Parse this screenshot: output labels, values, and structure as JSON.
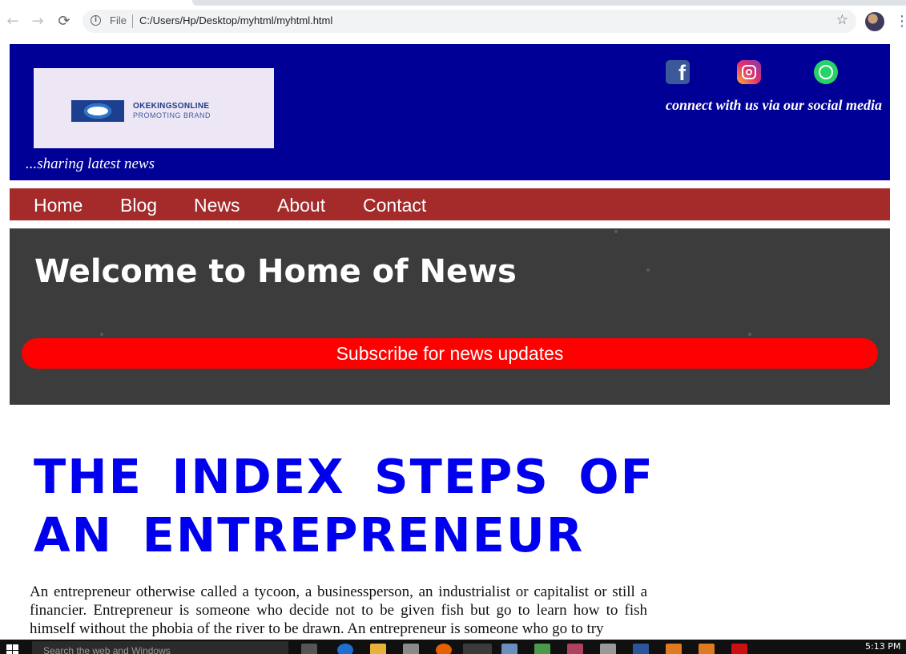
{
  "browser": {
    "file_label": "File",
    "url": "C:/Users/Hp/Desktop/myhtml/myhtml.html",
    "back_glyph": "←",
    "forward_glyph": "→",
    "reload_glyph": "⟳",
    "star_glyph": "☆",
    "menu_glyph": "⋮",
    "info_glyph": "i"
  },
  "header": {
    "logo_name": "OKEKINGSONLINE",
    "logo_tagline": "PROMOTING BRAND",
    "tagline": "...sharing latest news",
    "social_caption": "connect with us via our social media",
    "social_icons": [
      "facebook-icon",
      "instagram-icon",
      "whatsapp-icon"
    ],
    "facebook_glyph": "f",
    "background_color": "#000096"
  },
  "nav": {
    "items": [
      "Home",
      "Blog",
      "News",
      "About",
      "Contact"
    ],
    "background_color": "#a52a2a"
  },
  "hero": {
    "title": "Welcome to Home of News",
    "subscribe_label": "Subscribe for news updates",
    "button_color": "#ff0000"
  },
  "article": {
    "title": "THE INDEX STEPS OF AN ENTREPRENEUR",
    "body": "An entrepreneur otherwise called a tycoon, a businessperson, an industrialist or capitalist or still a financier. Entrepreneur is someone who decide not to be given fish but go to learn how to fish himself without the phobia of the river to be drawn. An entrepreneur is someone who go to try",
    "title_color": "#0000ee"
  },
  "taskbar": {
    "search_placeholder": "Search the web and Windows",
    "clock": "5:13 PM"
  }
}
